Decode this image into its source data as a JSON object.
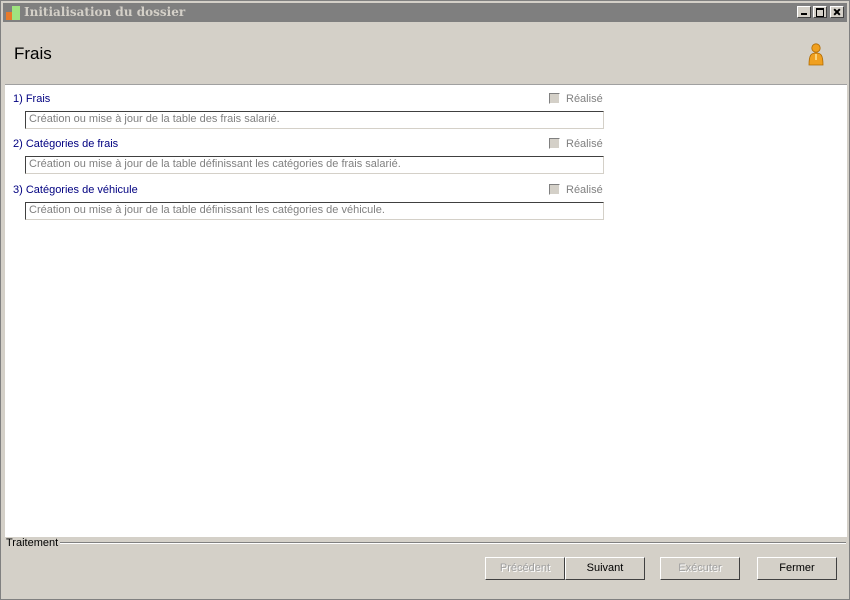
{
  "window": {
    "title": "Initialisation du dossier"
  },
  "header": {
    "title": "Frais"
  },
  "tasks": [
    {
      "label": "1) Frais",
      "done_label": "Réalisé",
      "description": "Création ou mise à jour de la table des frais salarié."
    },
    {
      "label": "2) Catégories de frais",
      "done_label": "Réalisé",
      "description": "Création ou mise à jour de la table définissant les catégories de frais salarié."
    },
    {
      "label": "3) Catégories de véhicule",
      "done_label": "Réalisé",
      "description": "Création ou mise à jour de la table définissant les catégories de véhicule."
    }
  ],
  "footer": {
    "group_label": "Traitement",
    "buttons": {
      "previous": "Précédent",
      "next": "Suivant",
      "execute": "Exécuter",
      "close": "Fermer"
    }
  },
  "colors": {
    "title_bar": "#7f7f7f",
    "task_label": "#000080",
    "person_icon": "#f0a020"
  }
}
